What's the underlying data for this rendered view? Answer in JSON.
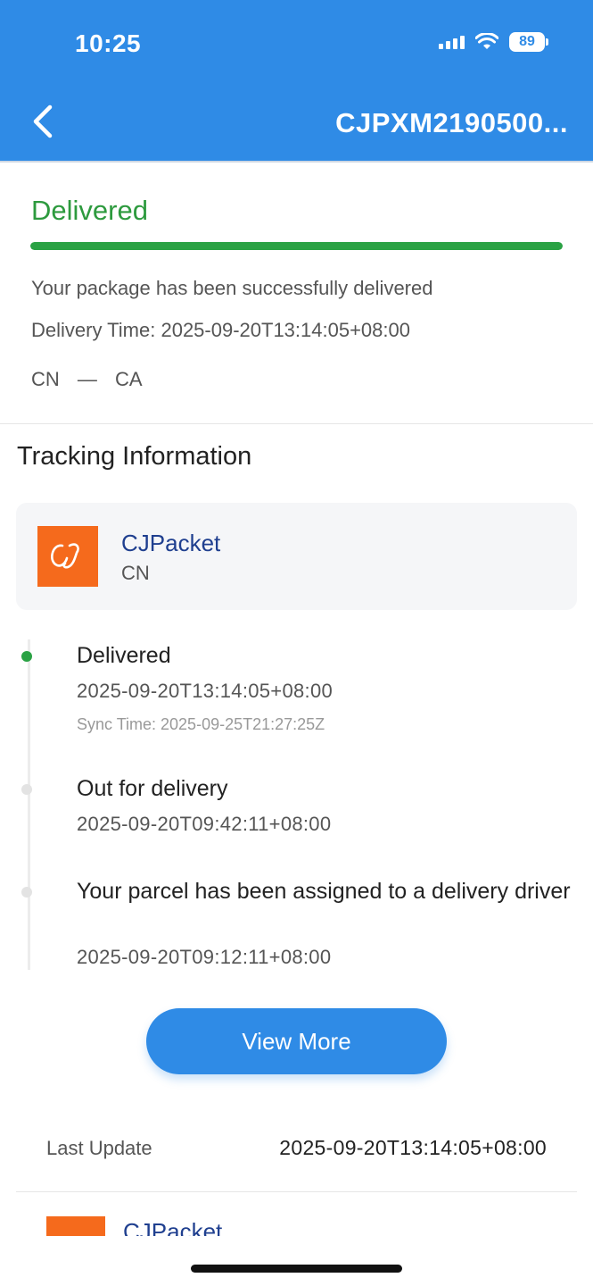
{
  "status_bar": {
    "time": "10:25",
    "battery": "89"
  },
  "header": {
    "title": "CJPXM2190500..."
  },
  "summary": {
    "status": "Delivered",
    "progress": 1.0,
    "message": "Your package has been successfully delivered",
    "delivery_time": "Delivery Time: 2025-09-20T13:14:05+08:00",
    "origin": "CN",
    "separator": "—",
    "destination": "CA"
  },
  "tracking": {
    "section_title": "Tracking Information",
    "carrier": {
      "name": "CJPacket",
      "country": "CN"
    },
    "events": [
      {
        "title": "Delivered",
        "time": "2025-09-20T13:14:05+08:00",
        "sync": "Sync Time: 2025-09-25T21:27:25Z"
      },
      {
        "title": "Out for delivery",
        "time": "2025-09-20T09:42:11+08:00"
      },
      {
        "title": "Your parcel has been assigned to a delivery driver",
        "time": "2025-09-20T09:12:11+08:00"
      }
    ],
    "view_more_label": "View More",
    "last_update_label": "Last Update",
    "last_update_value": "2025-09-20T13:14:05+08:00"
  },
  "next_card": {
    "carrier_name": "CJPacket"
  },
  "colors": {
    "header": "#2f8be6",
    "delivered": "#2d9a3e",
    "carrier_logo": "#f56a1c",
    "carrier_name": "#1f3f8f"
  }
}
